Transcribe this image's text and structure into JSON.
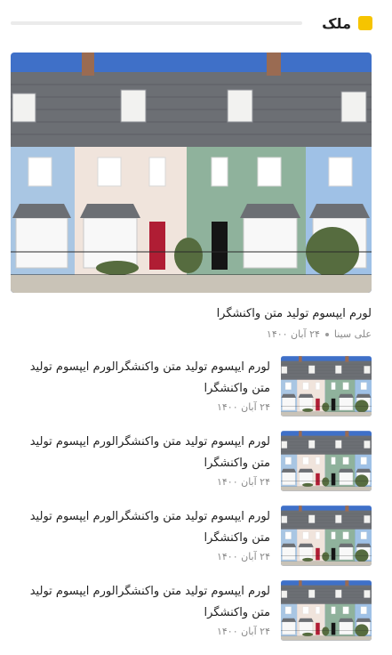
{
  "section": {
    "title": "ملک",
    "accent": "#f6c400"
  },
  "featured": {
    "image_icon": "row-houses-photo",
    "title": "لورم ایپسوم تولید متن واکنشگرا",
    "author": "علی سینا",
    "date": "۲۴ آبان ۱۴۰۰"
  },
  "items": [
    {
      "title": "لورم ایپسوم تولید متن واکنشگرالورم ایپسوم تولید متن واکنشگرا",
      "date": "۲۴ آبان ۱۴۰۰"
    },
    {
      "title": "لورم ایپسوم تولید متن واکنشگرالورم ایپسوم تولید متن واکنشگرا",
      "date": "۲۴ آبان ۱۴۰۰"
    },
    {
      "title": "لورم ایپسوم تولید متن واکنشگرالورم ایپسوم تولید متن واکنشگرا",
      "date": "۲۴ آبان ۱۴۰۰"
    },
    {
      "title": "لورم ایپسوم تولید متن واکنشگرالورم ایپسوم تولید متن واکنشگرا",
      "date": "۲۴ آبان ۱۴۰۰"
    }
  ]
}
